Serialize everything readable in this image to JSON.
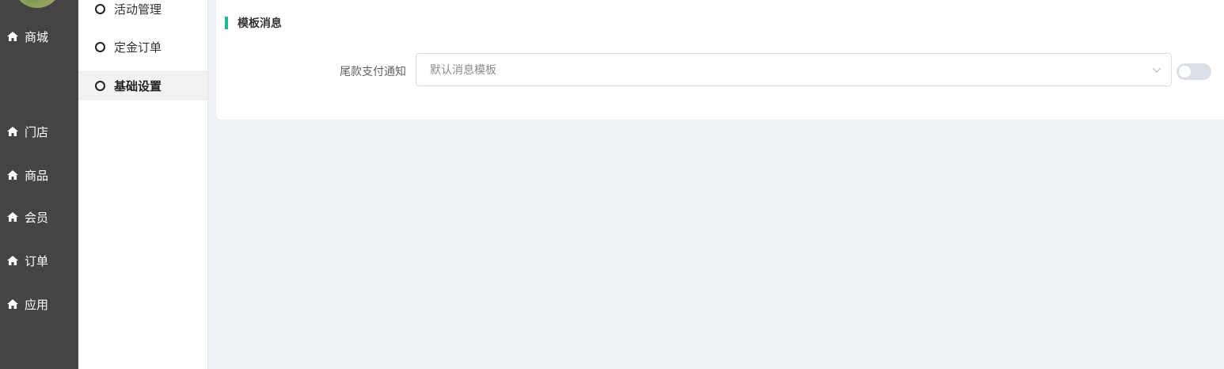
{
  "main_nav": {
    "items": [
      {
        "label": "商城",
        "icon": "home-icon"
      },
      {
        "label": "门店",
        "icon": "home-icon"
      },
      {
        "label": "商品",
        "icon": "home-icon"
      },
      {
        "label": "会员",
        "icon": "home-icon"
      },
      {
        "label": "订单",
        "icon": "home-icon"
      },
      {
        "label": "应用",
        "icon": "home-icon"
      }
    ]
  },
  "sub_nav": {
    "items": [
      {
        "label": "活动管理",
        "active": false
      },
      {
        "label": "定金订单",
        "active": false
      },
      {
        "label": "基础设置",
        "active": true
      }
    ]
  },
  "content": {
    "section_title": "模板消息",
    "form": {
      "label": "尾款支付通知",
      "select_placeholder": "默认消息模板",
      "switch_on": false
    }
  },
  "colors": {
    "nav_bg": "#444444",
    "accent": "#1fba94",
    "page_bg": "#eef1f4"
  }
}
